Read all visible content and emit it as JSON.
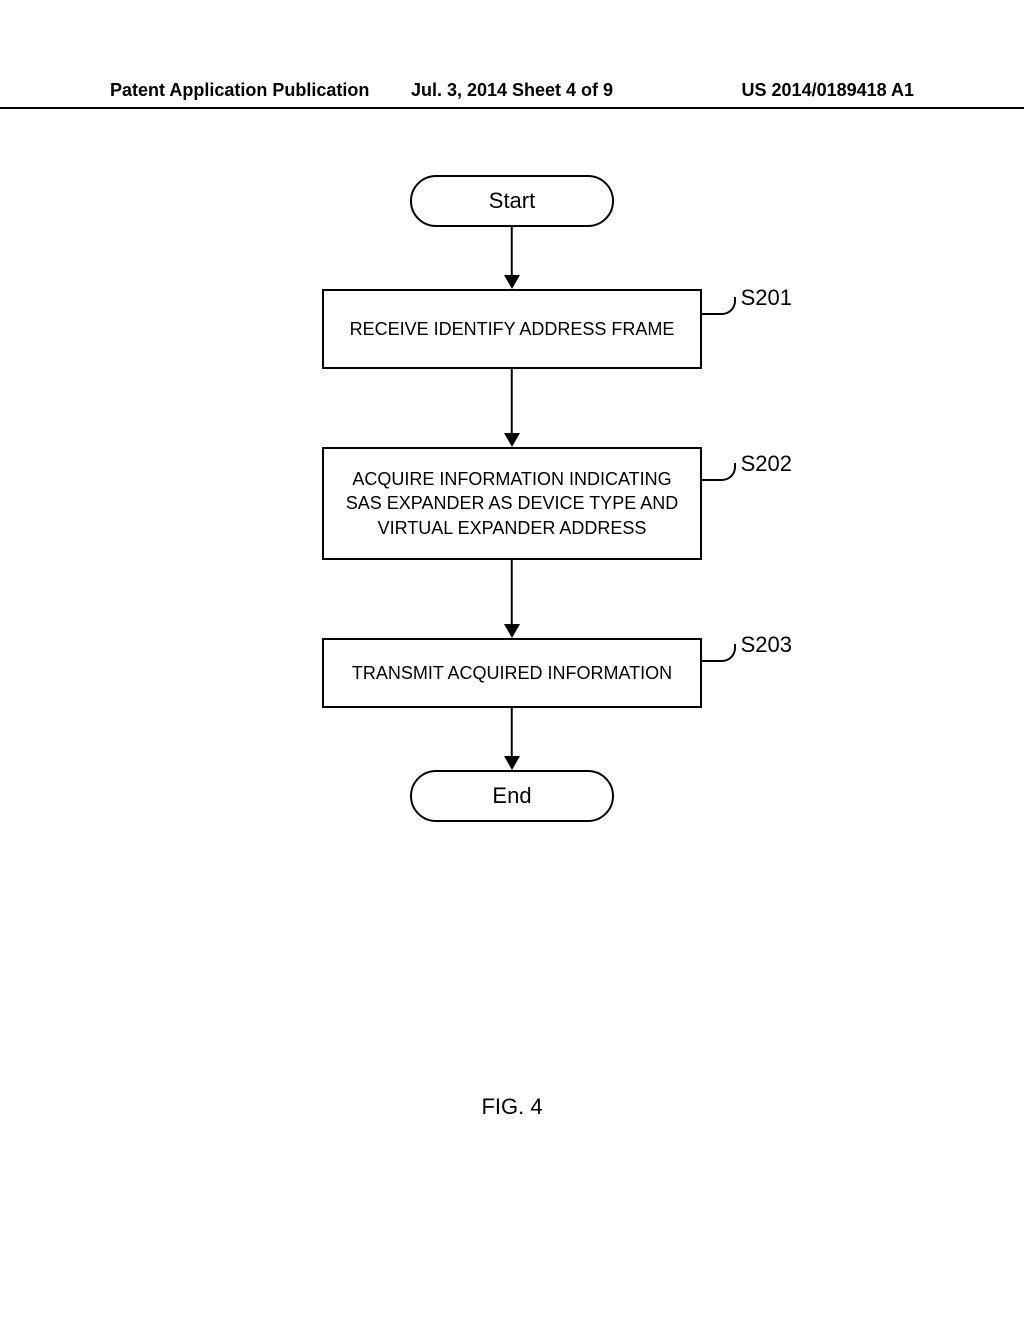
{
  "header": {
    "left": "Patent Application Publication",
    "center": "Jul. 3, 2014   Sheet 4 of 9",
    "right": "US 2014/0189418 A1"
  },
  "flowchart": {
    "start": "Start",
    "end": "End",
    "steps": [
      {
        "label": "S201",
        "text": "RECEIVE IDENTIFY ADDRESS FRAME"
      },
      {
        "label": "S202",
        "text": "ACQUIRE INFORMATION INDICATING SAS EXPANDER AS DEVICE TYPE AND VIRTUAL EXPANDER ADDRESS"
      },
      {
        "label": "S203",
        "text": "TRANSMIT ACQUIRED INFORMATION"
      }
    ]
  },
  "figure_label": "FIG. 4"
}
